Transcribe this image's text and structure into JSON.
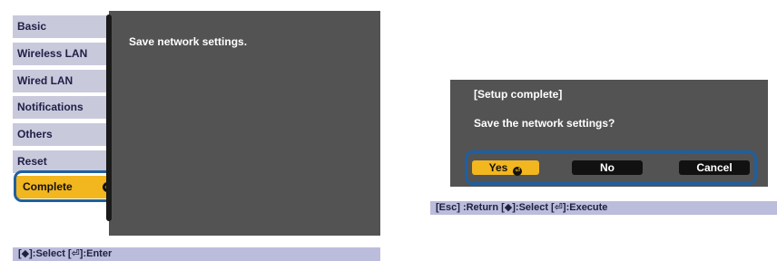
{
  "left_menu": {
    "items": [
      {
        "label": "Basic"
      },
      {
        "label": "Wireless LAN"
      },
      {
        "label": "Wired LAN"
      },
      {
        "label": "Notifications"
      },
      {
        "label": "Others"
      },
      {
        "label": "Reset"
      },
      {
        "label": "Complete",
        "selected": true
      }
    ]
  },
  "left_panel": {
    "message": "Save network settings."
  },
  "left_status": {
    "text": "[◆]:Select  [⏎]:Enter"
  },
  "dialog": {
    "title": "[Setup complete]",
    "question": "Save the network settings?",
    "buttons": [
      {
        "label": "Yes",
        "selected": true
      },
      {
        "label": "No"
      },
      {
        "label": "Cancel"
      }
    ]
  },
  "right_status": {
    "text": "[Esc] :Return  [◆]:Select  [⏎]:Execute"
  },
  "colors": {
    "panel_bg": "#535353",
    "menu_item_bg": "#c9c9dc",
    "highlight": "#f2b61f",
    "focus_frame": "#1f5fa0",
    "status_bar_bg": "#bcbcdc"
  },
  "icons": {
    "enter": "enter-return-icon"
  }
}
